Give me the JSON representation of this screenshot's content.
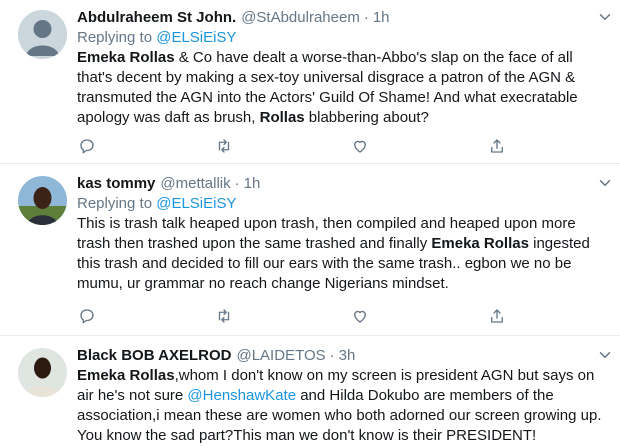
{
  "tweets": [
    {
      "name": "Abdulraheem St John.",
      "handle": "@StAbdulraheem",
      "dot": "·",
      "time": "1h",
      "replying_prefix": "Replying to ",
      "replying_to": "@ELSiEiSY",
      "body": [
        {
          "t": "Emeka Rollas",
          "b": true
        },
        {
          "t": " & Co have dealt a worse-than-Abbo's slap on the face of all that's decent by making a sex-toy universal disgrace a patron of the AGN & transmuted the AGN into the Actors' Guild Of Shame! And what execratable apology was daft as brush, "
        },
        {
          "t": "Rollas",
          "b": true
        },
        {
          "t": " blabbering about?"
        }
      ]
    },
    {
      "name": "kas tommy",
      "handle": "@mettallik",
      "dot": "·",
      "time": "1h",
      "replying_prefix": "Replying to ",
      "replying_to": "@ELSiEiSY",
      "body": [
        {
          "t": "This is trash talk heaped upon trash, then compiled and heaped upon more trash then trashed upon the same trashed and finally "
        },
        {
          "t": "Emeka Rollas",
          "b": true
        },
        {
          "t": " ingested this trash and decided to fill our ears with the same trash.. egbon we no be mumu, ur grammar no reach change Nigerians mindset."
        }
      ]
    },
    {
      "name": "Black BOB AXELROD",
      "handle": "@LAIDETOS",
      "dot": "·",
      "time": "3h",
      "body": [
        {
          "t": "Emeka Rollas",
          "b": true
        },
        {
          "t": ",whom I don't know on my screen is president AGN but says on air he's not sure "
        },
        {
          "t": "@HenshawKate",
          "m": true
        },
        {
          "t": " and Hilda Dokubo are  members of the association,i mean these are women who both adorned our screen growing up. You know the sad part?This man we don't know is their PRESIDENT!"
        }
      ]
    }
  ],
  "icons": [
    "reply-icon",
    "retweet-icon",
    "like-icon",
    "share-icon",
    "caret-down-icon"
  ],
  "colors": {
    "link": "#1b95e0",
    "muted": "#657786",
    "text": "#14171a",
    "divider": "#e6ecf0"
  }
}
